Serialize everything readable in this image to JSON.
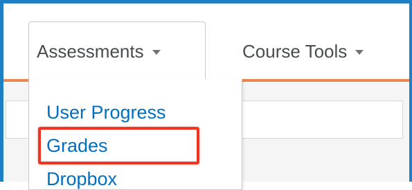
{
  "nav": {
    "assessments_label": "Assessments",
    "course_tools_label": "Course Tools"
  },
  "dropdown": {
    "items": [
      {
        "label": "User Progress"
      },
      {
        "label": "Grades",
        "highlighted": true
      },
      {
        "label": "Dropbox"
      }
    ]
  },
  "colors": {
    "frame_border": "#1f7fc4",
    "nav_underline": "#e9864a",
    "link": "#006fbf",
    "highlight_box": "#ee3524",
    "nav_text": "#494c4e"
  },
  "icons": {
    "dropdown_caret": "chevron-down-icon"
  }
}
